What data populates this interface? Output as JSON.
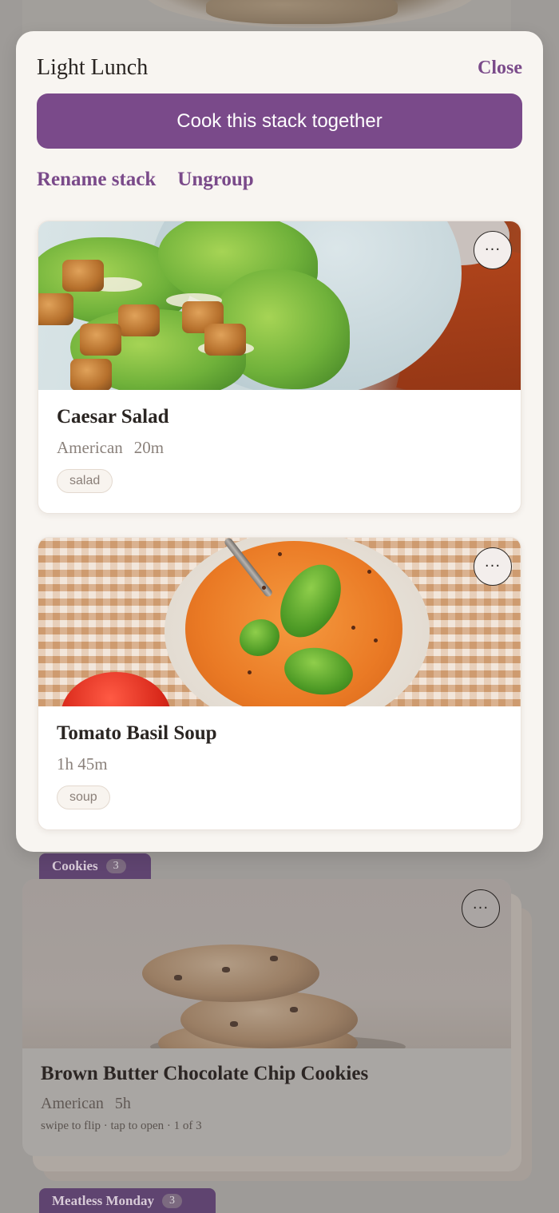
{
  "background": {
    "stacks": [
      {
        "name": "Cookies",
        "count": "3"
      },
      {
        "name": "Meatless Monday",
        "count": "3"
      }
    ],
    "top_card": {
      "title": "Brown Butter Chocolate Chip Cookies",
      "cuisine": "American",
      "time": "5h",
      "hint": "swipe to flip · tap to open · 1 of 3",
      "more_label": "···"
    }
  },
  "sheet": {
    "title": "Light Lunch",
    "close_label": "Close",
    "cook_button_label": "Cook this stack together",
    "rename_label": "Rename stack",
    "ungroup_label": "Ungroup",
    "recipes": [
      {
        "title": "Caesar Salad",
        "cuisine": "American",
        "time": "20m",
        "tag": "salad",
        "more_label": "···"
      },
      {
        "title": "Tomato Basil Soup",
        "time": "1h 45m",
        "tag": "soup",
        "more_label": "···"
      }
    ]
  },
  "colors": {
    "accent": "#7a4a8a",
    "sheet_bg": "#f8f5f1",
    "backdrop": "#9e9b98"
  }
}
